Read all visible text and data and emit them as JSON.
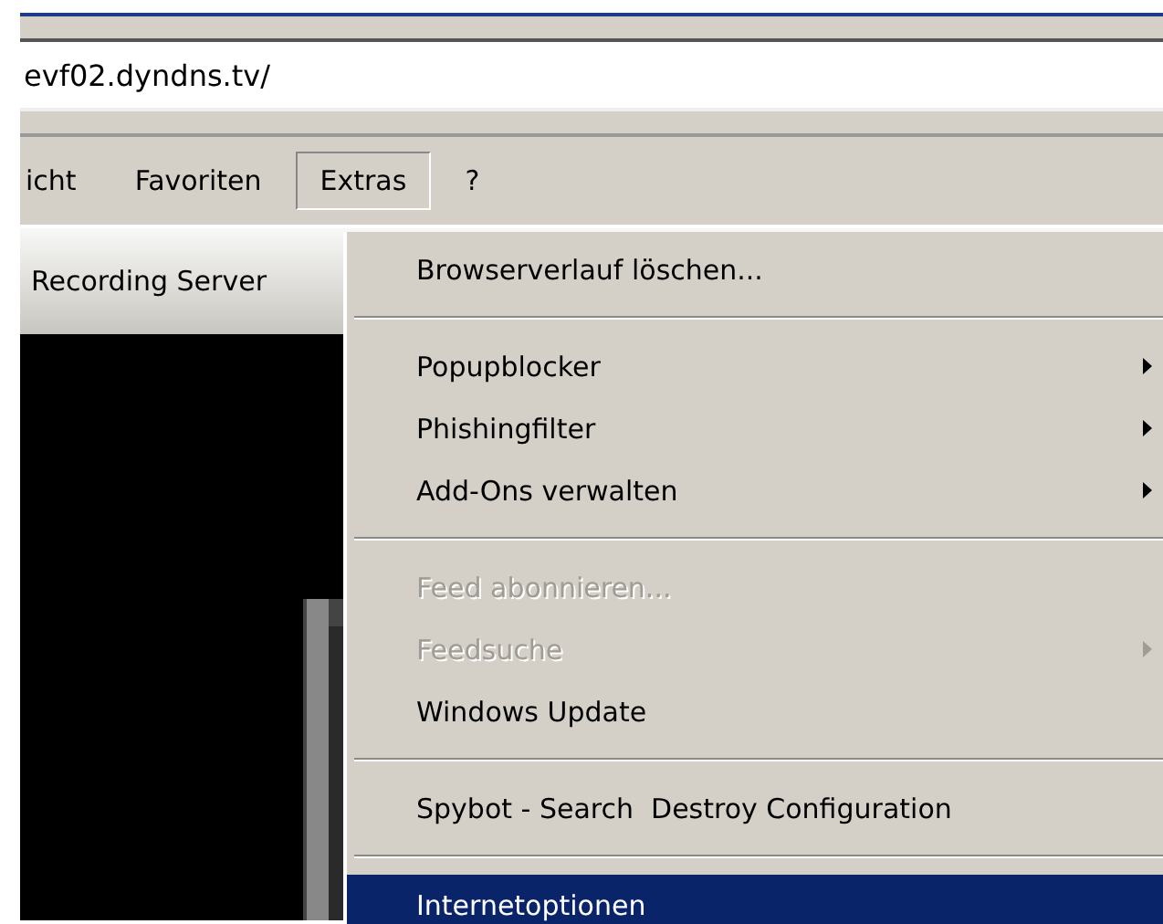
{
  "address_bar": {
    "value": "evf02.dyndns.tv/"
  },
  "menu_bar": [
    {
      "label": "icht",
      "selected": false
    },
    {
      "label": "Favoriten",
      "selected": false
    },
    {
      "label": "Extras",
      "selected": true
    },
    {
      "label": "?",
      "selected": false
    }
  ],
  "tab": {
    "label": "Recording Server"
  },
  "dropdown_menu": [
    {
      "kind": "item",
      "label": "Browserverlauf löschen...",
      "disabled": false,
      "submenu": false,
      "selected": false
    },
    {
      "kind": "separator"
    },
    {
      "kind": "item",
      "label": "Popupblocker",
      "disabled": false,
      "submenu": true,
      "selected": false
    },
    {
      "kind": "item",
      "label": "Phishingfilter",
      "disabled": false,
      "submenu": true,
      "selected": false
    },
    {
      "kind": "item",
      "label": "Add-Ons verwalten",
      "disabled": false,
      "submenu": true,
      "selected": false
    },
    {
      "kind": "separator"
    },
    {
      "kind": "item",
      "label": "Feed abonnieren...",
      "disabled": true,
      "submenu": false,
      "selected": false
    },
    {
      "kind": "item",
      "label": "Feedsuche",
      "disabled": true,
      "submenu": true,
      "selected": false
    },
    {
      "kind": "item",
      "label": "Windows Update",
      "disabled": false,
      "submenu": false,
      "selected": false
    },
    {
      "kind": "separator"
    },
    {
      "kind": "item",
      "label": "Spybot - Search  Destroy Configuration",
      "disabled": false,
      "submenu": false,
      "selected": false
    },
    {
      "kind": "separator"
    },
    {
      "kind": "item",
      "label": "Internetoptionen",
      "disabled": false,
      "submenu": false,
      "selected": true
    }
  ]
}
